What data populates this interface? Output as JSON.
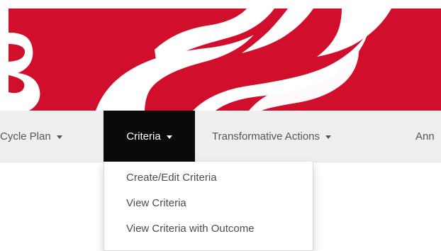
{
  "header": {
    "banner_colors": {
      "primary": "#d10f2d",
      "accent": "#ffffff"
    }
  },
  "navbar": {
    "items": [
      {
        "label": "Cycle Plan"
      },
      {
        "label": "Criteria"
      },
      {
        "label": "Transformative Actions"
      },
      {
        "label": "Ann"
      }
    ],
    "active_item": "Criteria",
    "colors": {
      "bar": "#eeeeee",
      "active": "#0a0a0a",
      "text": "#555555",
      "active_text": "#ffffff"
    }
  },
  "dropdown": {
    "items": [
      {
        "label": "Create/Edit Criteria"
      },
      {
        "label": "View Criteria"
      },
      {
        "label": "View Criteria with Outcome"
      }
    ]
  }
}
